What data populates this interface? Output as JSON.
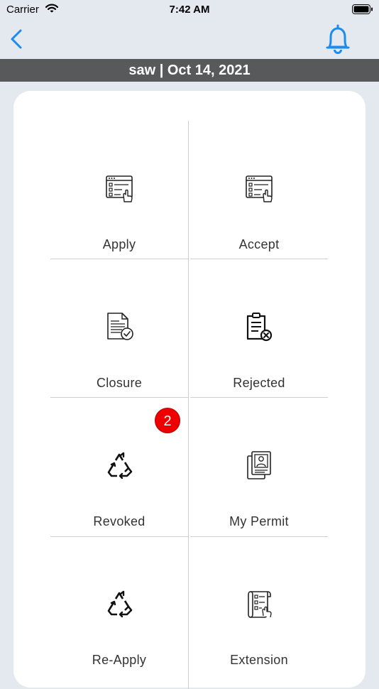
{
  "status_bar": {
    "carrier": "Carrier",
    "time": "7:42 AM"
  },
  "nav": {
    "back_icon": "chevron-left-icon",
    "notification_icon": "bell-icon",
    "accent_color": "#1a8cf0"
  },
  "header": {
    "title": "saw | Oct 14, 2021"
  },
  "menu": {
    "items": [
      {
        "label": "Apply",
        "icon": "form-click-icon"
      },
      {
        "label": "Accept",
        "icon": "form-click-icon"
      },
      {
        "label": "Closure",
        "icon": "document-check-icon"
      },
      {
        "label": "Rejected",
        "icon": "document-reject-icon"
      },
      {
        "label": "Revoked",
        "icon": "recycle-icon",
        "badge": "2"
      },
      {
        "label": "My Permit",
        "icon": "id-card-icon"
      },
      {
        "label": "Re-Apply",
        "icon": "recycle-icon"
      },
      {
        "label": "Extension",
        "icon": "scroll-checklist-icon"
      }
    ]
  },
  "colors": {
    "background": "#e4e9f0",
    "title_bar": "#58595b",
    "badge": "#ee0000"
  }
}
